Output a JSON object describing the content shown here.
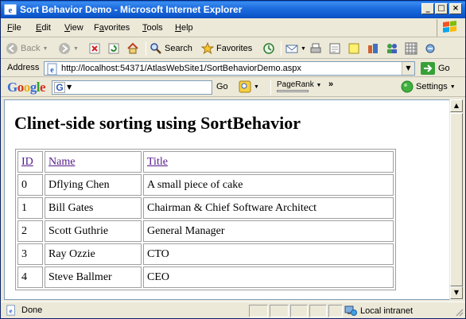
{
  "window": {
    "title": "Sort Behavior Demo - Microsoft Internet Explorer"
  },
  "menu": {
    "items": [
      {
        "label": "File",
        "accel": "F",
        "rest": "ile"
      },
      {
        "label": "Edit",
        "accel": "E",
        "rest": "dit"
      },
      {
        "label": "View",
        "accel": "V",
        "rest": "iew"
      },
      {
        "label": "Favorites",
        "accel": "a",
        "pre": "F",
        "rest": "vorites"
      },
      {
        "label": "Tools",
        "accel": "T",
        "rest": "ools"
      },
      {
        "label": "Help",
        "accel": "H",
        "rest": "elp"
      }
    ]
  },
  "toolbar": {
    "back_label": "Back",
    "search_label": "Search",
    "favorites_label": "Favorites"
  },
  "address": {
    "label": "Address",
    "url": "http://localhost:54371/AtlasWebSite1/SortBehaviorDemo.aspx",
    "go_label": "Go"
  },
  "google": {
    "logo": "Google",
    "search_placeholder": "",
    "go_label": "Go",
    "pagerank_label": "PageRank",
    "settings_label": "Settings"
  },
  "page": {
    "heading": "Clinet-side sorting using SortBehavior",
    "columns": [
      "ID",
      "Name",
      "Title"
    ],
    "rows": [
      [
        "0",
        "Dflying Chen",
        "A small piece of cake"
      ],
      [
        "1",
        "Bill Gates",
        "Chairman & Chief Software Architect"
      ],
      [
        "2",
        "Scott Guthrie",
        "General Manager"
      ],
      [
        "3",
        "Ray Ozzie",
        "CTO"
      ],
      [
        "4",
        "Steve Ballmer",
        "CEO"
      ]
    ]
  },
  "status": {
    "text": "Done",
    "zone": "Local intranet"
  },
  "colors": {
    "titlebar": "#0a5fd8",
    "link_visited": "#551a8b",
    "chrome": "#ece9d8"
  }
}
